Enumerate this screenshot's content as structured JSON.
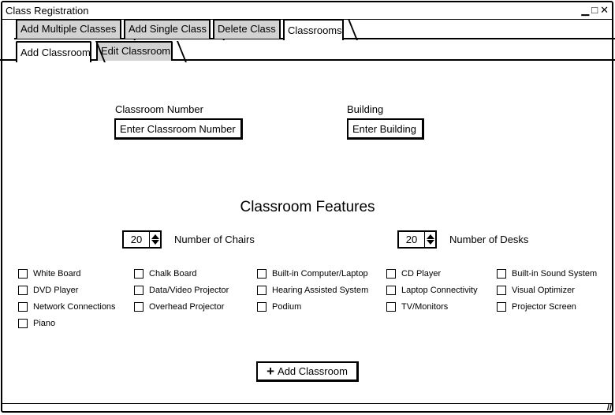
{
  "window": {
    "title": "Class Registration",
    "controls": {
      "minimize": "▁",
      "maximize": "□",
      "close": "✕"
    }
  },
  "tabs_top": [
    {
      "label": "Add Multiple Classes",
      "active": false
    },
    {
      "label": "Add Single Class",
      "active": false
    },
    {
      "label": "Delete Class",
      "active": false
    },
    {
      "label": "Classrooms",
      "active": true
    }
  ],
  "tabs_sub": [
    {
      "label": "Add Classroom",
      "active": true
    },
    {
      "label": "Edit Classroom",
      "active": false
    }
  ],
  "form": {
    "classroom_number_label": "Classroom Number",
    "classroom_number_placeholder": "Enter Classroom Number",
    "building_label": "Building",
    "building_placeholder": "Enter Building"
  },
  "features": {
    "title": "Classroom Features",
    "chairs": {
      "value": "20",
      "label": "Number of Chairs"
    },
    "desks": {
      "value": "20",
      "label": "Number of Desks"
    },
    "checkboxes": [
      [
        "White Board",
        "DVD Player",
        "Network Connections",
        "Piano"
      ],
      [
        "Chalk Board",
        "Data/Video Projector",
        "Overhead Projector"
      ],
      [
        "Built-in Computer/Laptop",
        "Hearing Assisted System",
        "Podium"
      ],
      [
        "CD Player",
        "Laptop Connectivity",
        "TV/Monitors"
      ],
      [
        "Built-in Sound System",
        "Visual Optimizer",
        "Projector Screen"
      ]
    ]
  },
  "submit": {
    "icon": "plus-icon",
    "label": "Add Classroom"
  }
}
